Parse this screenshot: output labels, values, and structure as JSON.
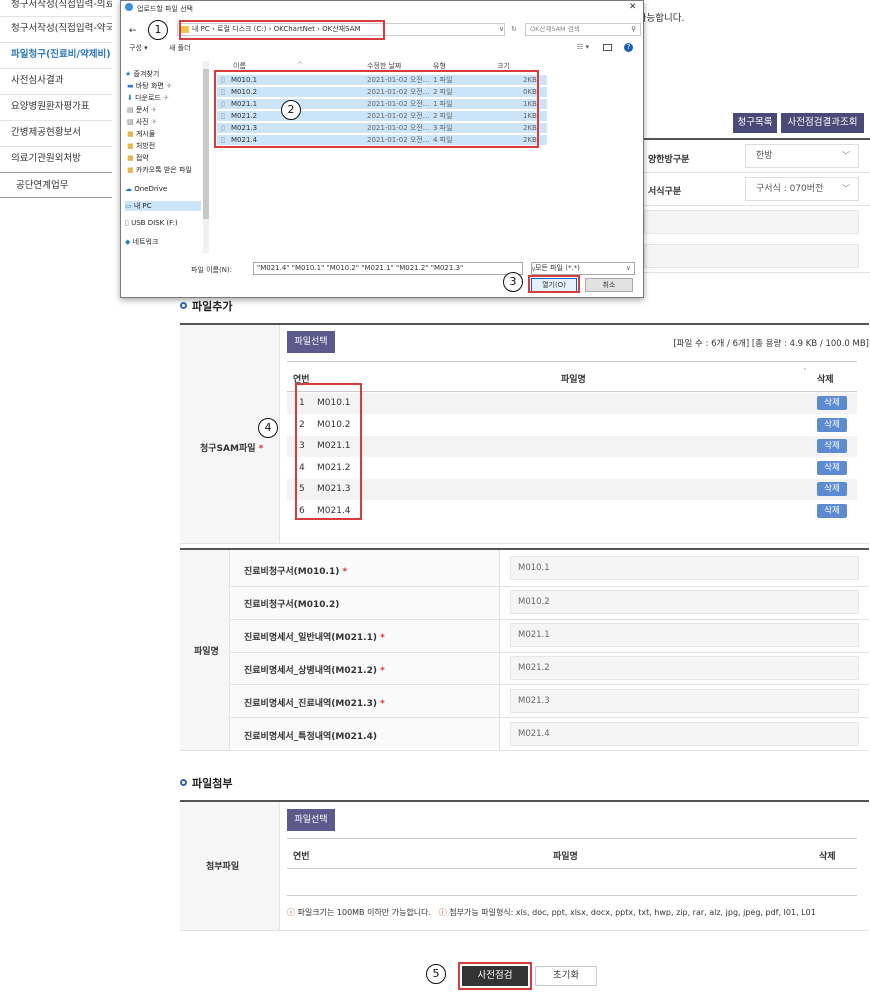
{
  "sidebar": {
    "items": [
      {
        "label": "청구서작성(직접입력-의료기관)"
      },
      {
        "label": "청구서작성(직접입력-약국)"
      },
      {
        "label": "파일청구(진료비/약제비)"
      },
      {
        "label": "사전심사결과"
      },
      {
        "label": "요양병원환자평가표"
      },
      {
        "label": "간병제공현황보서"
      },
      {
        "label": "의료기관원외처방"
      },
      {
        "label": "공단연계업무"
      }
    ]
  },
  "notice_text": "구 가능합니다.",
  "buttons": {
    "claim_list": "청구목록",
    "precheck_result": "사전점검결과조회",
    "precheck": "사전점검",
    "reset": "초기화"
  },
  "form": {
    "oriental_label": "양한방구분",
    "oriental_value": "한방",
    "format_label": "서식구분",
    "format_value": "구서식 : 070버전"
  },
  "dialog": {
    "title": "업로드할 파일 선택",
    "close": "✕",
    "path": [
      "내 PC",
      "로컬 디스크 (C:)",
      "OKChartNet",
      "OK산재SAM"
    ],
    "search_placeholder": "OK산재SAM 검색",
    "organize": "구성 ▾",
    "new_folder": "새 폴더",
    "tree": [
      {
        "label": "즐겨찾기",
        "icon": "star-icon"
      },
      {
        "label": "바탕 화면",
        "icon": "desktop-icon"
      },
      {
        "label": "다운로드",
        "icon": "download-icon"
      },
      {
        "label": "문서",
        "icon": "document-icon"
      },
      {
        "label": "사진",
        "icon": "picture-icon"
      },
      {
        "label": "게시물",
        "icon": "folder-icon"
      },
      {
        "label": "처방전",
        "icon": "folder-icon"
      },
      {
        "label": "접약",
        "icon": "folder-icon"
      },
      {
        "label": "카카오톡 받은 파일",
        "icon": "folder-icon"
      },
      {
        "label": "OneDrive",
        "icon": "cloud-icon"
      },
      {
        "label": "내 PC",
        "icon": "pc-icon"
      },
      {
        "label": "USB DISK (F:)",
        "icon": "usb-icon"
      },
      {
        "label": "네트워크",
        "icon": "network-icon"
      }
    ],
    "columns": {
      "name": "이름",
      "modified": "수정한 날짜",
      "type": "유형",
      "size": "크기"
    },
    "files": [
      {
        "name": "M010.1",
        "modified": "2021-01-02 오전...",
        "type": "1 파일",
        "size": "2KB"
      },
      {
        "name": "M010.2",
        "modified": "2021-01-02 오전...",
        "type": "2 파일",
        "size": "0KB"
      },
      {
        "name": "M021.1",
        "modified": "2021-01-02 오전...",
        "type": "1 파일",
        "size": "1KB"
      },
      {
        "name": "M021.2",
        "modified": "2021-01-02 오전...",
        "type": "2 파일",
        "size": "1KB"
      },
      {
        "name": "M021.3",
        "modified": "2021-01-02 오전...",
        "type": "3 파일",
        "size": "2KB"
      },
      {
        "name": "M021.4",
        "modified": "2021-01-02 오전...",
        "type": "4 파일",
        "size": "2KB"
      }
    ],
    "filename_label": "파일 이름(N):",
    "filename_value": "\"M021.4\" \"M010.1\" \"M010.2\" \"M021.1\" \"M021.2\" \"M021.3\"",
    "filter_value": "모든 파일 (*.*)",
    "open": "열기(O)",
    "cancel": "취소"
  },
  "file_add": {
    "title": "파일추가",
    "select_button": "파일선택",
    "summary": "[파일 수 : 6개 / 6개] [총 용량 : 4.9 KB / 100.0 MB]",
    "row_label": "청구SAM파일",
    "col_no": "연번",
    "col_name": "파일명",
    "col_del": "삭제",
    "rows": [
      {
        "no": "1",
        "name": "M010.1",
        "del": "삭제"
      },
      {
        "no": "2",
        "name": "M010.2",
        "del": "삭제"
      },
      {
        "no": "3",
        "name": "M021.1",
        "del": "삭제"
      },
      {
        "no": "4",
        "name": "M021.2",
        "del": "삭제"
      },
      {
        "no": "5",
        "name": "M021.3",
        "del": "삭제"
      },
      {
        "no": "6",
        "name": "M021.4",
        "del": "삭제"
      }
    ]
  },
  "filenames": {
    "label": "파일명",
    "rows": [
      {
        "label": "진료비청구서(M010.1)",
        "required": true,
        "value": "M010.1"
      },
      {
        "label": "진료비청구서(M010.2)",
        "required": false,
        "value": "M010.2"
      },
      {
        "label": "진료비명세서_일반내역(M021.1)",
        "required": true,
        "value": "M021.1"
      },
      {
        "label": "진료비명세서_상병내역(M021.2)",
        "required": true,
        "value": "M021.2"
      },
      {
        "label": "진료비명세서_진료내역(M021.3)",
        "required": true,
        "value": "M021.3"
      },
      {
        "label": "진료비명세서_특정내역(M021.4)",
        "required": false,
        "value": "M021.4"
      }
    ]
  },
  "attach": {
    "title": "파일첨부",
    "select_button": "파일선택",
    "row_label": "첨부파일",
    "col_no": "연번",
    "col_name": "파일명",
    "col_del": "삭제",
    "note1": "파일크기는 100MB 이하만 가능합니다.",
    "note2": "첨부가능 파일형식: xls, doc, ppt, xlsx, docx, pptx, txt, hwp, zip, rar, alz, jpg, jpeg, pdf, I01, L01"
  },
  "required_mark": "*",
  "markers": [
    "1",
    "2",
    "3",
    "4",
    "5"
  ],
  "colors": {
    "accent": "#2b78b8",
    "dark_button": "#4a4a78",
    "delete": "#5c8bd1",
    "highlight": "#d93c3c",
    "selection": "#cce4f7"
  }
}
